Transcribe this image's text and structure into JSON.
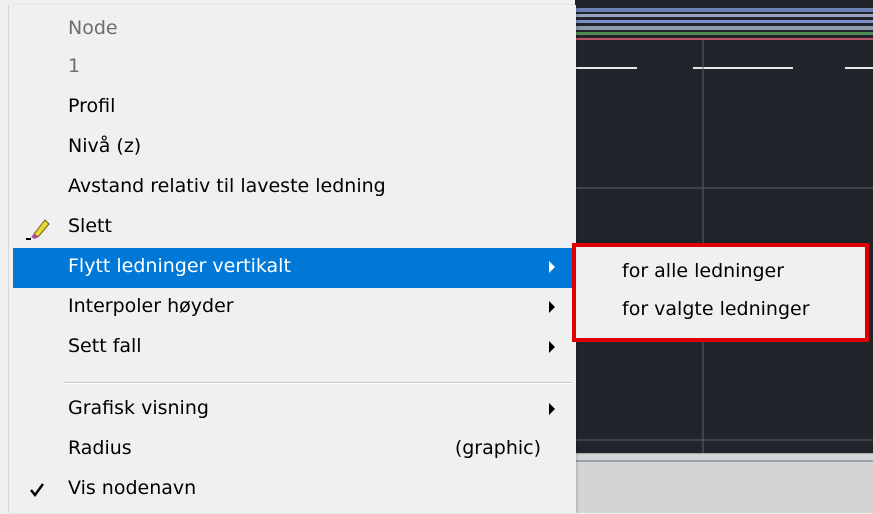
{
  "menu": {
    "items": [
      {
        "label": "Node",
        "state": "disabled"
      },
      {
        "label": "1",
        "state": "disabled"
      },
      {
        "label": "Profil"
      },
      {
        "label": "Nivå (z)"
      },
      {
        "label": "Avstand relativ til laveste ledning"
      },
      {
        "label": "Slett",
        "icon": "eraser-icon"
      },
      {
        "label": "Flytt ledninger vertikalt",
        "submenu": true,
        "selected": true
      },
      {
        "label": "Interpoler høyder",
        "submenu": true
      },
      {
        "label": "Sett fall",
        "submenu": true
      },
      {
        "label": "Grafisk visning",
        "submenu": true
      },
      {
        "label": "Radius",
        "shortcut": "(graphic)"
      },
      {
        "label": "Vis nodenavn",
        "checked": true
      }
    ]
  },
  "submenu": {
    "items": [
      {
        "label": "for alle ledninger"
      },
      {
        "label": "for valgte ledninger"
      }
    ],
    "highlight_color": "#e00000"
  },
  "colors": {
    "menu_bg": "#f0f0f0",
    "selected_bg": "#0078d7",
    "viewport_bg": "#20242b"
  }
}
